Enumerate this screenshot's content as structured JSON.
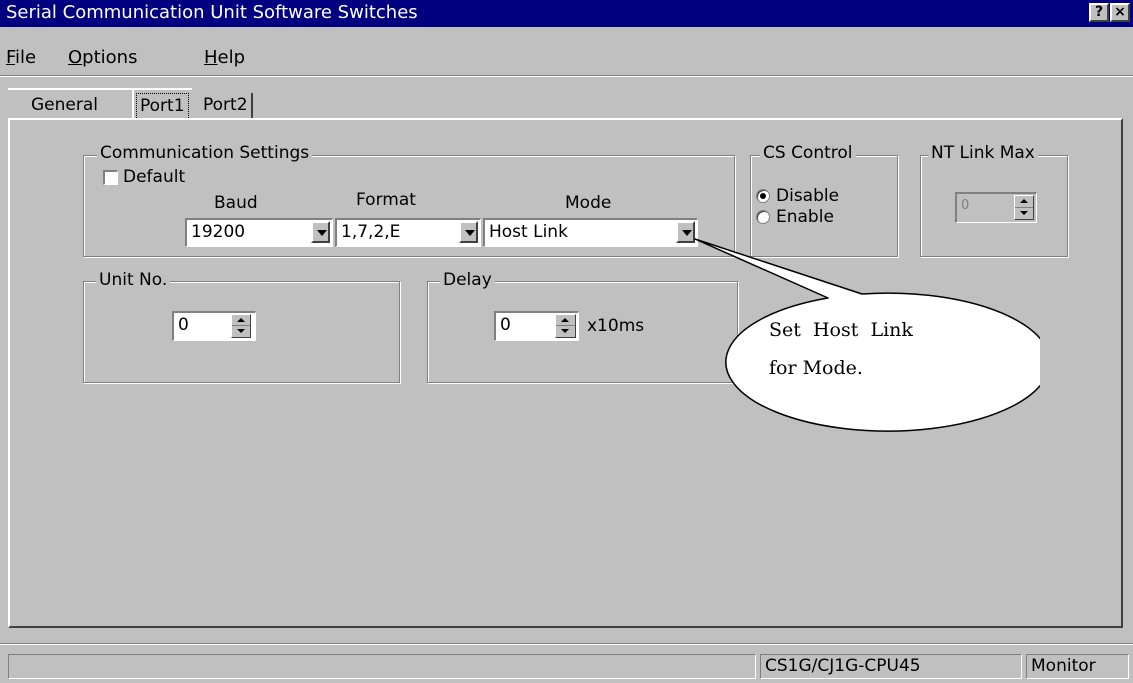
{
  "window": {
    "title": "Serial Communication Unit Software Switches",
    "help_button": "?",
    "close_button": "×"
  },
  "menu": {
    "file": {
      "hotkey": "F",
      "rest": "ile"
    },
    "options": {
      "hotkey": "O",
      "rest": "ptions"
    },
    "help": {
      "hotkey": "H",
      "rest": "elp"
    }
  },
  "tabs": {
    "general": "General",
    "port1": "Port1",
    "port2": "Port2",
    "active": "Port1"
  },
  "communication_settings": {
    "label": "Communication Settings",
    "default_label": "Default",
    "default_checked": false,
    "baud_label": "Baud",
    "baud_value": "19200",
    "format_label": "Format",
    "format_value": "1,7,2,E",
    "mode_label": "Mode",
    "mode_value": "Host Link"
  },
  "cs_control": {
    "label": "CS Control",
    "options": [
      "Disable",
      "Enable"
    ],
    "selected": "Disable"
  },
  "nt_link_max": {
    "label": "NT Link Max",
    "value": "0"
  },
  "unit_no": {
    "label": "Unit No.",
    "value": "0"
  },
  "delay": {
    "label": "Delay",
    "value": "0",
    "unit": "x10ms"
  },
  "callout": {
    "line1": "Set  Host  Link",
    "line2": "for Mode."
  },
  "status_bar": {
    "model": "CS1G/CJ1G-CPU45",
    "mode": "Monitor"
  }
}
